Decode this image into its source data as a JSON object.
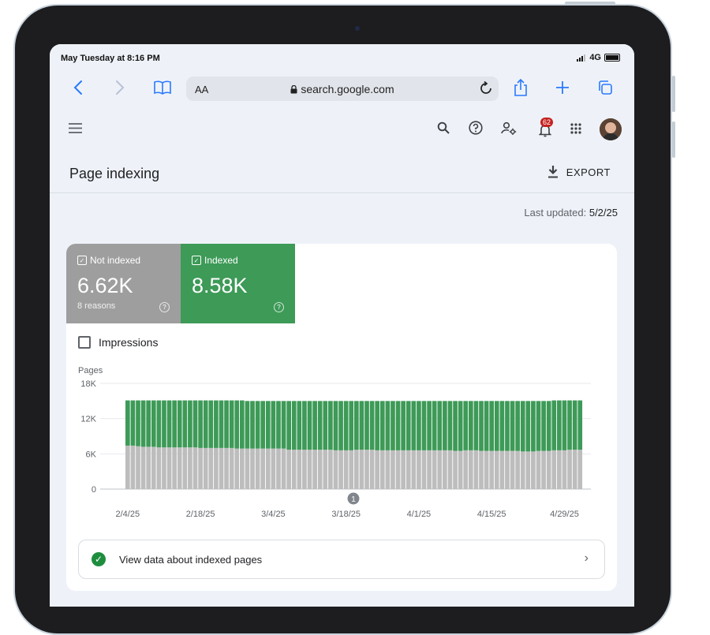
{
  "status_bar": {
    "time": "May Tuesday at 8:16 PM",
    "signal": "4G"
  },
  "browser": {
    "text_size_label": "AA",
    "url": "search.google.com"
  },
  "gsc_header": {
    "notification_count": "62"
  },
  "page": {
    "title": "Page indexing",
    "export_label": "EXPORT",
    "last_updated_label": "Last updated:",
    "last_updated_value": "5/2/25"
  },
  "summary": {
    "not_indexed": {
      "label": "Not indexed",
      "value": "6.62K",
      "sub": "8 reasons",
      "color": "#9e9e9e"
    },
    "indexed": {
      "label": "Indexed",
      "value": "8.58K",
      "color": "#3d9a57"
    }
  },
  "impressions_label": "Impressions",
  "view_data_label": "View data about indexed pages",
  "chart_annotation": "1",
  "chart_data": {
    "type": "bar",
    "stacked": true,
    "ylabel": "Pages",
    "ylim": [
      0,
      18000
    ],
    "yticks": [
      "0",
      "6K",
      "12K",
      "18K"
    ],
    "xticks": [
      "2/4/25",
      "2/18/25",
      "3/4/25",
      "3/18/25",
      "4/1/25",
      "4/15/25",
      "4/29/25"
    ],
    "x": [
      "2/4/25",
      "2/5/25",
      "2/6/25",
      "2/7/25",
      "2/8/25",
      "2/9/25",
      "2/10/25",
      "2/11/25",
      "2/12/25",
      "2/13/25",
      "2/14/25",
      "2/15/25",
      "2/16/25",
      "2/17/25",
      "2/18/25",
      "2/19/25",
      "2/20/25",
      "2/21/25",
      "2/22/25",
      "2/23/25",
      "2/24/25",
      "2/25/25",
      "2/26/25",
      "2/27/25",
      "2/28/25",
      "3/1/25",
      "3/2/25",
      "3/3/25",
      "3/4/25",
      "3/5/25",
      "3/6/25",
      "3/7/25",
      "3/8/25",
      "3/9/25",
      "3/10/25",
      "3/11/25",
      "3/12/25",
      "3/13/25",
      "3/14/25",
      "3/15/25",
      "3/16/25",
      "3/17/25",
      "3/18/25",
      "3/19/25",
      "3/20/25",
      "3/21/25",
      "3/22/25",
      "3/23/25",
      "3/24/25",
      "3/25/25",
      "3/26/25",
      "3/27/25",
      "3/28/25",
      "3/29/25",
      "3/30/25",
      "3/31/25",
      "4/1/25",
      "4/2/25",
      "4/3/25",
      "4/4/25",
      "4/5/25",
      "4/6/25",
      "4/7/25",
      "4/8/25",
      "4/9/25",
      "4/10/25",
      "4/11/25",
      "4/12/25",
      "4/13/25",
      "4/14/25",
      "4/15/25",
      "4/16/25",
      "4/17/25",
      "4/18/25",
      "4/19/25",
      "4/20/25",
      "4/21/25",
      "4/22/25",
      "4/23/25",
      "4/24/25",
      "4/25/25",
      "4/26/25",
      "4/27/25",
      "4/28/25",
      "4/29/25",
      "4/30/25",
      "5/1/25",
      "5/2/25"
    ],
    "series": [
      {
        "name": "Not indexed",
        "color": "#bdbdbd",
        "values": [
          7400,
          7400,
          7300,
          7200,
          7200,
          7200,
          7100,
          7100,
          7100,
          7100,
          7100,
          7100,
          7100,
          7100,
          7000,
          7000,
          7000,
          7000,
          7000,
          7000,
          7000,
          6900,
          6900,
          6900,
          6900,
          6900,
          6900,
          6900,
          6900,
          6900,
          6900,
          6700,
          6700,
          6700,
          6700,
          6700,
          6700,
          6700,
          6700,
          6700,
          6600,
          6600,
          6600,
          6600,
          6700,
          6700,
          6700,
          6700,
          6600,
          6600,
          6600,
          6600,
          6600,
          6600,
          6600,
          6600,
          6600,
          6600,
          6600,
          6600,
          6600,
          6600,
          6600,
          6500,
          6500,
          6600,
          6600,
          6600,
          6500,
          6500,
          6500,
          6500,
          6500,
          6500,
          6500,
          6500,
          6400,
          6400,
          6400,
          6500,
          6500,
          6500,
          6600,
          6600,
          6600,
          6700,
          6700,
          6700
        ]
      },
      {
        "name": "Indexed",
        "color": "#3d9a57",
        "values": [
          7700,
          7700,
          7800,
          7900,
          7900,
          7900,
          8000,
          8000,
          8000,
          8000,
          8000,
          8000,
          8000,
          8000,
          8100,
          8100,
          8100,
          8100,
          8100,
          8100,
          8100,
          8200,
          8200,
          8100,
          8100,
          8100,
          8100,
          8100,
          8100,
          8100,
          8100,
          8300,
          8300,
          8300,
          8300,
          8300,
          8300,
          8300,
          8300,
          8300,
          8400,
          8400,
          8400,
          8400,
          8300,
          8300,
          8300,
          8300,
          8400,
          8400,
          8400,
          8400,
          8400,
          8400,
          8400,
          8400,
          8400,
          8400,
          8400,
          8400,
          8400,
          8400,
          8400,
          8500,
          8500,
          8400,
          8400,
          8400,
          8500,
          8500,
          8500,
          8500,
          8500,
          8500,
          8500,
          8500,
          8600,
          8600,
          8600,
          8500,
          8500,
          8500,
          8500,
          8500,
          8500,
          8400,
          8400,
          8400
        ]
      }
    ]
  }
}
